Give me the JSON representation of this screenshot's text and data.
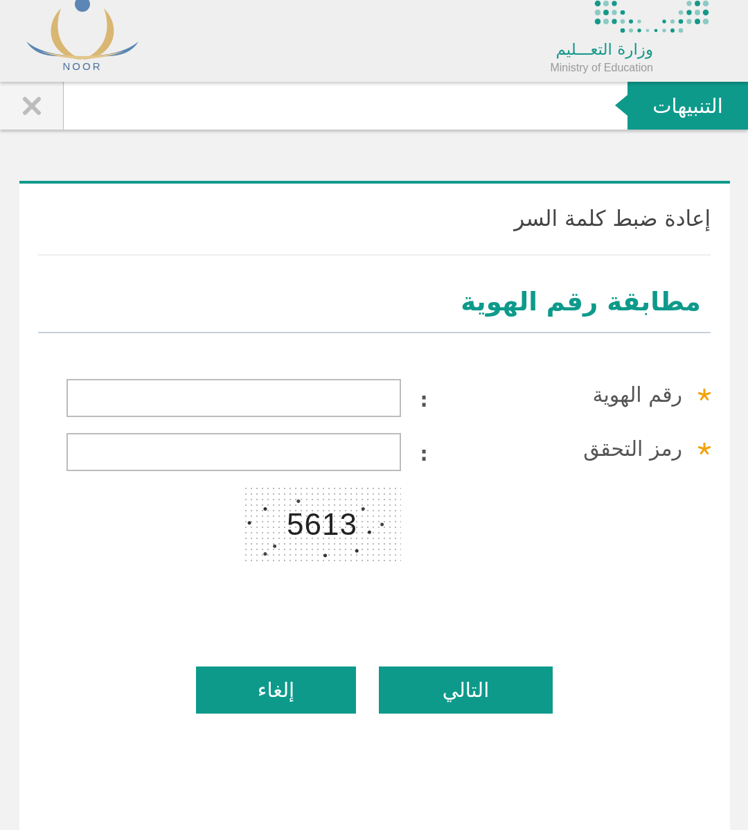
{
  "header": {
    "ministry_logo": {
      "arabic_name": "وزارة التعـــليم",
      "english_name": "Ministry of Education"
    },
    "noor_logo": {
      "name": "NOOR"
    }
  },
  "alerts_bar": {
    "title": "التنبيهات"
  },
  "card": {
    "title": "إعادة ضبط كلمة السر",
    "section_title": "مطابقة رقم الهوية"
  },
  "form": {
    "fields": [
      {
        "label": "رقم الهوية",
        "separator": ":",
        "required": true
      },
      {
        "label": "رمز التحقق",
        "separator": ":",
        "required": true
      }
    ],
    "captcha": {
      "code": "5613"
    }
  },
  "buttons": [
    {
      "label": "التالي"
    },
    {
      "label": "إلغاء"
    }
  ]
}
